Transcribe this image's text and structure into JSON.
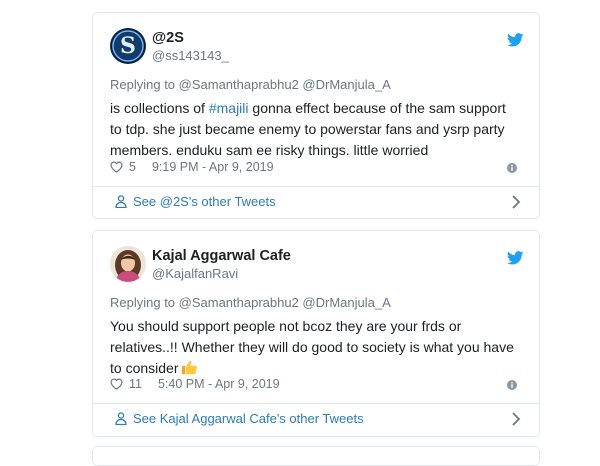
{
  "tweets": [
    {
      "name": "@2S",
      "handle": "@ss143143_",
      "replying": "Replying to @Samanthaprabhu2 @DrManjula_A",
      "text_before": "is collections of ",
      "hashtag": "#majili",
      "text_after": " gonna effect because of the sam support to tdp. she just became enemy to powerstar fans and ysrp party members. enduku sam ee risky things. little worried",
      "likes": "5",
      "time": "9:19 PM - Apr 9, 2019",
      "footer": "See @2S's other Tweets"
    },
    {
      "name": "Kajal Aggarwal Cafe",
      "handle": "@KajalfanRavi",
      "replying": "Replying to @Samanthaprabhu2 @DrManjula_A",
      "text": "You should support people not bcoz they are your frds or relatives..!! Whether they will do good to society is what you have to consider",
      "emoji": "thumbs-up",
      "likes": "11",
      "time": "5:40 PM - Apr 9, 2019",
      "footer": "See Kajal Aggarwal Cafe's other Tweets"
    }
  ],
  "colors": {
    "link": "#2b7bb9",
    "muted": "#697882",
    "twitter_blue": "#1da1f2",
    "border": "#e1e8ed"
  }
}
